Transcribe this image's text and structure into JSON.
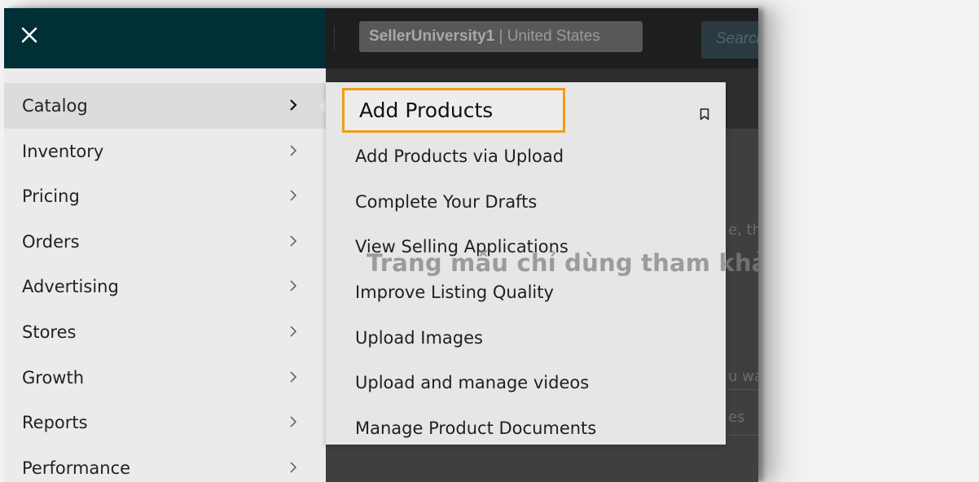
{
  "header": {
    "account_store": "SellerUniversity1",
    "account_region": "United States",
    "search_placeholder": "Search"
  },
  "background_fragments": {
    "text_1": "e, th",
    "text_2": "u wa",
    "text_3": "es"
  },
  "side_menu": {
    "items": [
      {
        "label": "Catalog",
        "active": true
      },
      {
        "label": "Inventory"
      },
      {
        "label": "Pricing"
      },
      {
        "label": "Orders"
      },
      {
        "label": "Advertising"
      },
      {
        "label": "Stores"
      },
      {
        "label": "Growth"
      },
      {
        "label": "Reports"
      },
      {
        "label": "Performance"
      }
    ]
  },
  "submenu": {
    "items": [
      {
        "label": "Add Products",
        "highlighted": true,
        "highlight_color": "#f39c12"
      },
      {
        "label": "Add Products via Upload"
      },
      {
        "label": "Complete Your Drafts"
      },
      {
        "label": "View Selling Applications"
      },
      {
        "label": "Improve Listing Quality"
      },
      {
        "label": "Upload Images"
      },
      {
        "label": "Upload and manage videos"
      },
      {
        "label": "Manage Product Documents"
      }
    ]
  },
  "watermark": "Trang mẫu chỉ dùng tham khảo",
  "colors": {
    "panel_header": "#002f36",
    "highlight_border": "#f39c12"
  }
}
